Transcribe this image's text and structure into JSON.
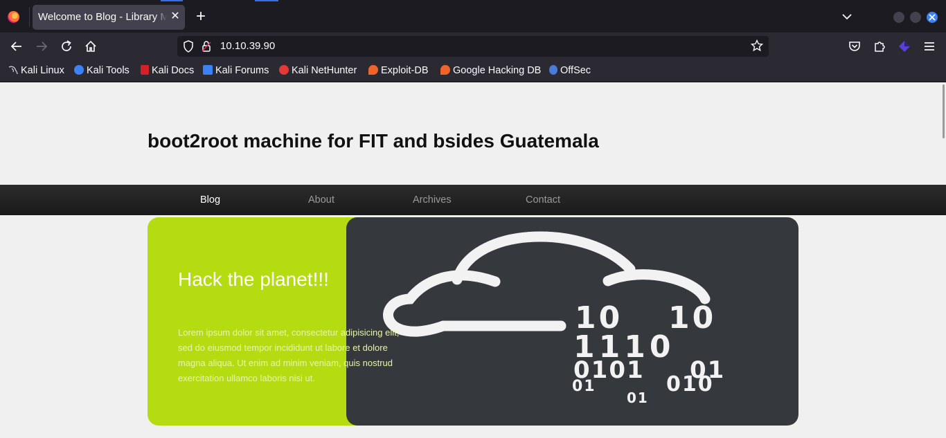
{
  "browser": {
    "tab_title": "Welcome to Blog - Library Machine",
    "url": "10.10.39.90",
    "bookmarks": [
      {
        "label": "Kali Linux",
        "icon": "kali-dragon-icon",
        "color": "#cfcfd8"
      },
      {
        "label": "Kali Tools",
        "icon": "kali-tools-icon",
        "color": "#3b82f6"
      },
      {
        "label": "Kali Docs",
        "icon": "kali-docs-icon",
        "color": "#d71f26"
      },
      {
        "label": "Kali Forums",
        "icon": "kali-forums-icon",
        "color": "#3b82f6"
      },
      {
        "label": "Kali NetHunter",
        "icon": "nethunter-icon",
        "color": "#e53935"
      },
      {
        "label": "Exploit-DB",
        "icon": "exploit-db-icon",
        "color": "#f0642a"
      },
      {
        "label": "Google Hacking DB",
        "icon": "ghdb-icon",
        "color": "#f0642a"
      },
      {
        "label": "OffSec",
        "icon": "offsec-icon",
        "color": "#4a7bd8"
      }
    ]
  },
  "site": {
    "title": "boot2root machine for FIT and bsides Guatemala",
    "nav": [
      "Blog",
      "About",
      "Archives",
      "Contact"
    ],
    "hero": {
      "heading": "Hack the planet!!!",
      "text": "Lorem ipsum dolor sit amet, consectetur adipisicing elit, sed do eiusmod tempor incididunt ut labore et dolore magna aliqua. Ut enim ad minim veniam, quis nostrud exercitation ullamco laboris nisi ut.",
      "image_digits": [
        "10",
        "10",
        "1110",
        "0101",
        "01",
        "01",
        "010",
        "01"
      ]
    }
  },
  "colors": {
    "hero_green": "#b5dc10",
    "hero_dark": "#35383d",
    "nav_bg": "#1f1f1f",
    "browser_accent": "#3b82f6"
  }
}
